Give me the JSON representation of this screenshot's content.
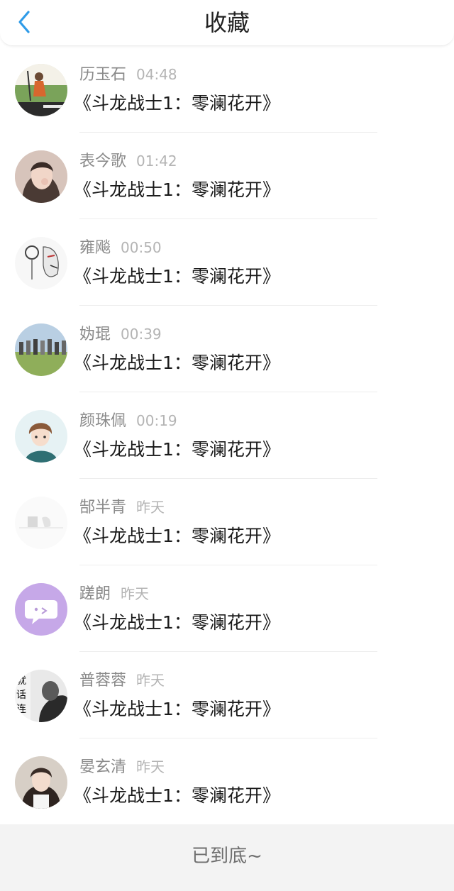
{
  "header": {
    "title": "收藏",
    "back_icon": "chevron-left-icon",
    "accent_color": "#2f9be8"
  },
  "items": [
    {
      "name": "历玉石",
      "time": "04:48",
      "work": "《斗龙战士1：零澜花开》",
      "avatar": "avatar-photo-outdoor"
    },
    {
      "name": "表今歌",
      "time": "01:42",
      "work": "《斗龙战士1：零澜花开》",
      "avatar": "avatar-photo-woman"
    },
    {
      "name": "雍飚",
      "time": "00:50",
      "work": "《斗龙战士1：零澜花开》",
      "avatar": "avatar-illustration-sketch"
    },
    {
      "name": "妫琨",
      "time": "00:39",
      "work": "《斗龙战士1：零澜花开》",
      "avatar": "avatar-photo-group"
    },
    {
      "name": "颜珠佩",
      "time": "00:19",
      "work": "《斗龙战士1：零澜花开》",
      "avatar": "avatar-illustration-girl"
    },
    {
      "name": "郜半青",
      "time": "昨天",
      "work": "《斗龙战士1：零澜花开》",
      "avatar": "avatar-faded-sketch"
    },
    {
      "name": "蹉朗",
      "time": "昨天",
      "work": "《斗龙战士1：零澜花开》",
      "avatar": "avatar-chat-bubble"
    },
    {
      "name": "普蓉蓉",
      "time": "昨天",
      "work": "《斗龙战士1：零澜花开》",
      "avatar": "avatar-bw-text"
    },
    {
      "name": "晏玄清",
      "time": "昨天",
      "work": "《斗龙战士1：零澜花开》",
      "avatar": "avatar-photo-girl"
    }
  ],
  "footer": {
    "text": "已到底~"
  }
}
